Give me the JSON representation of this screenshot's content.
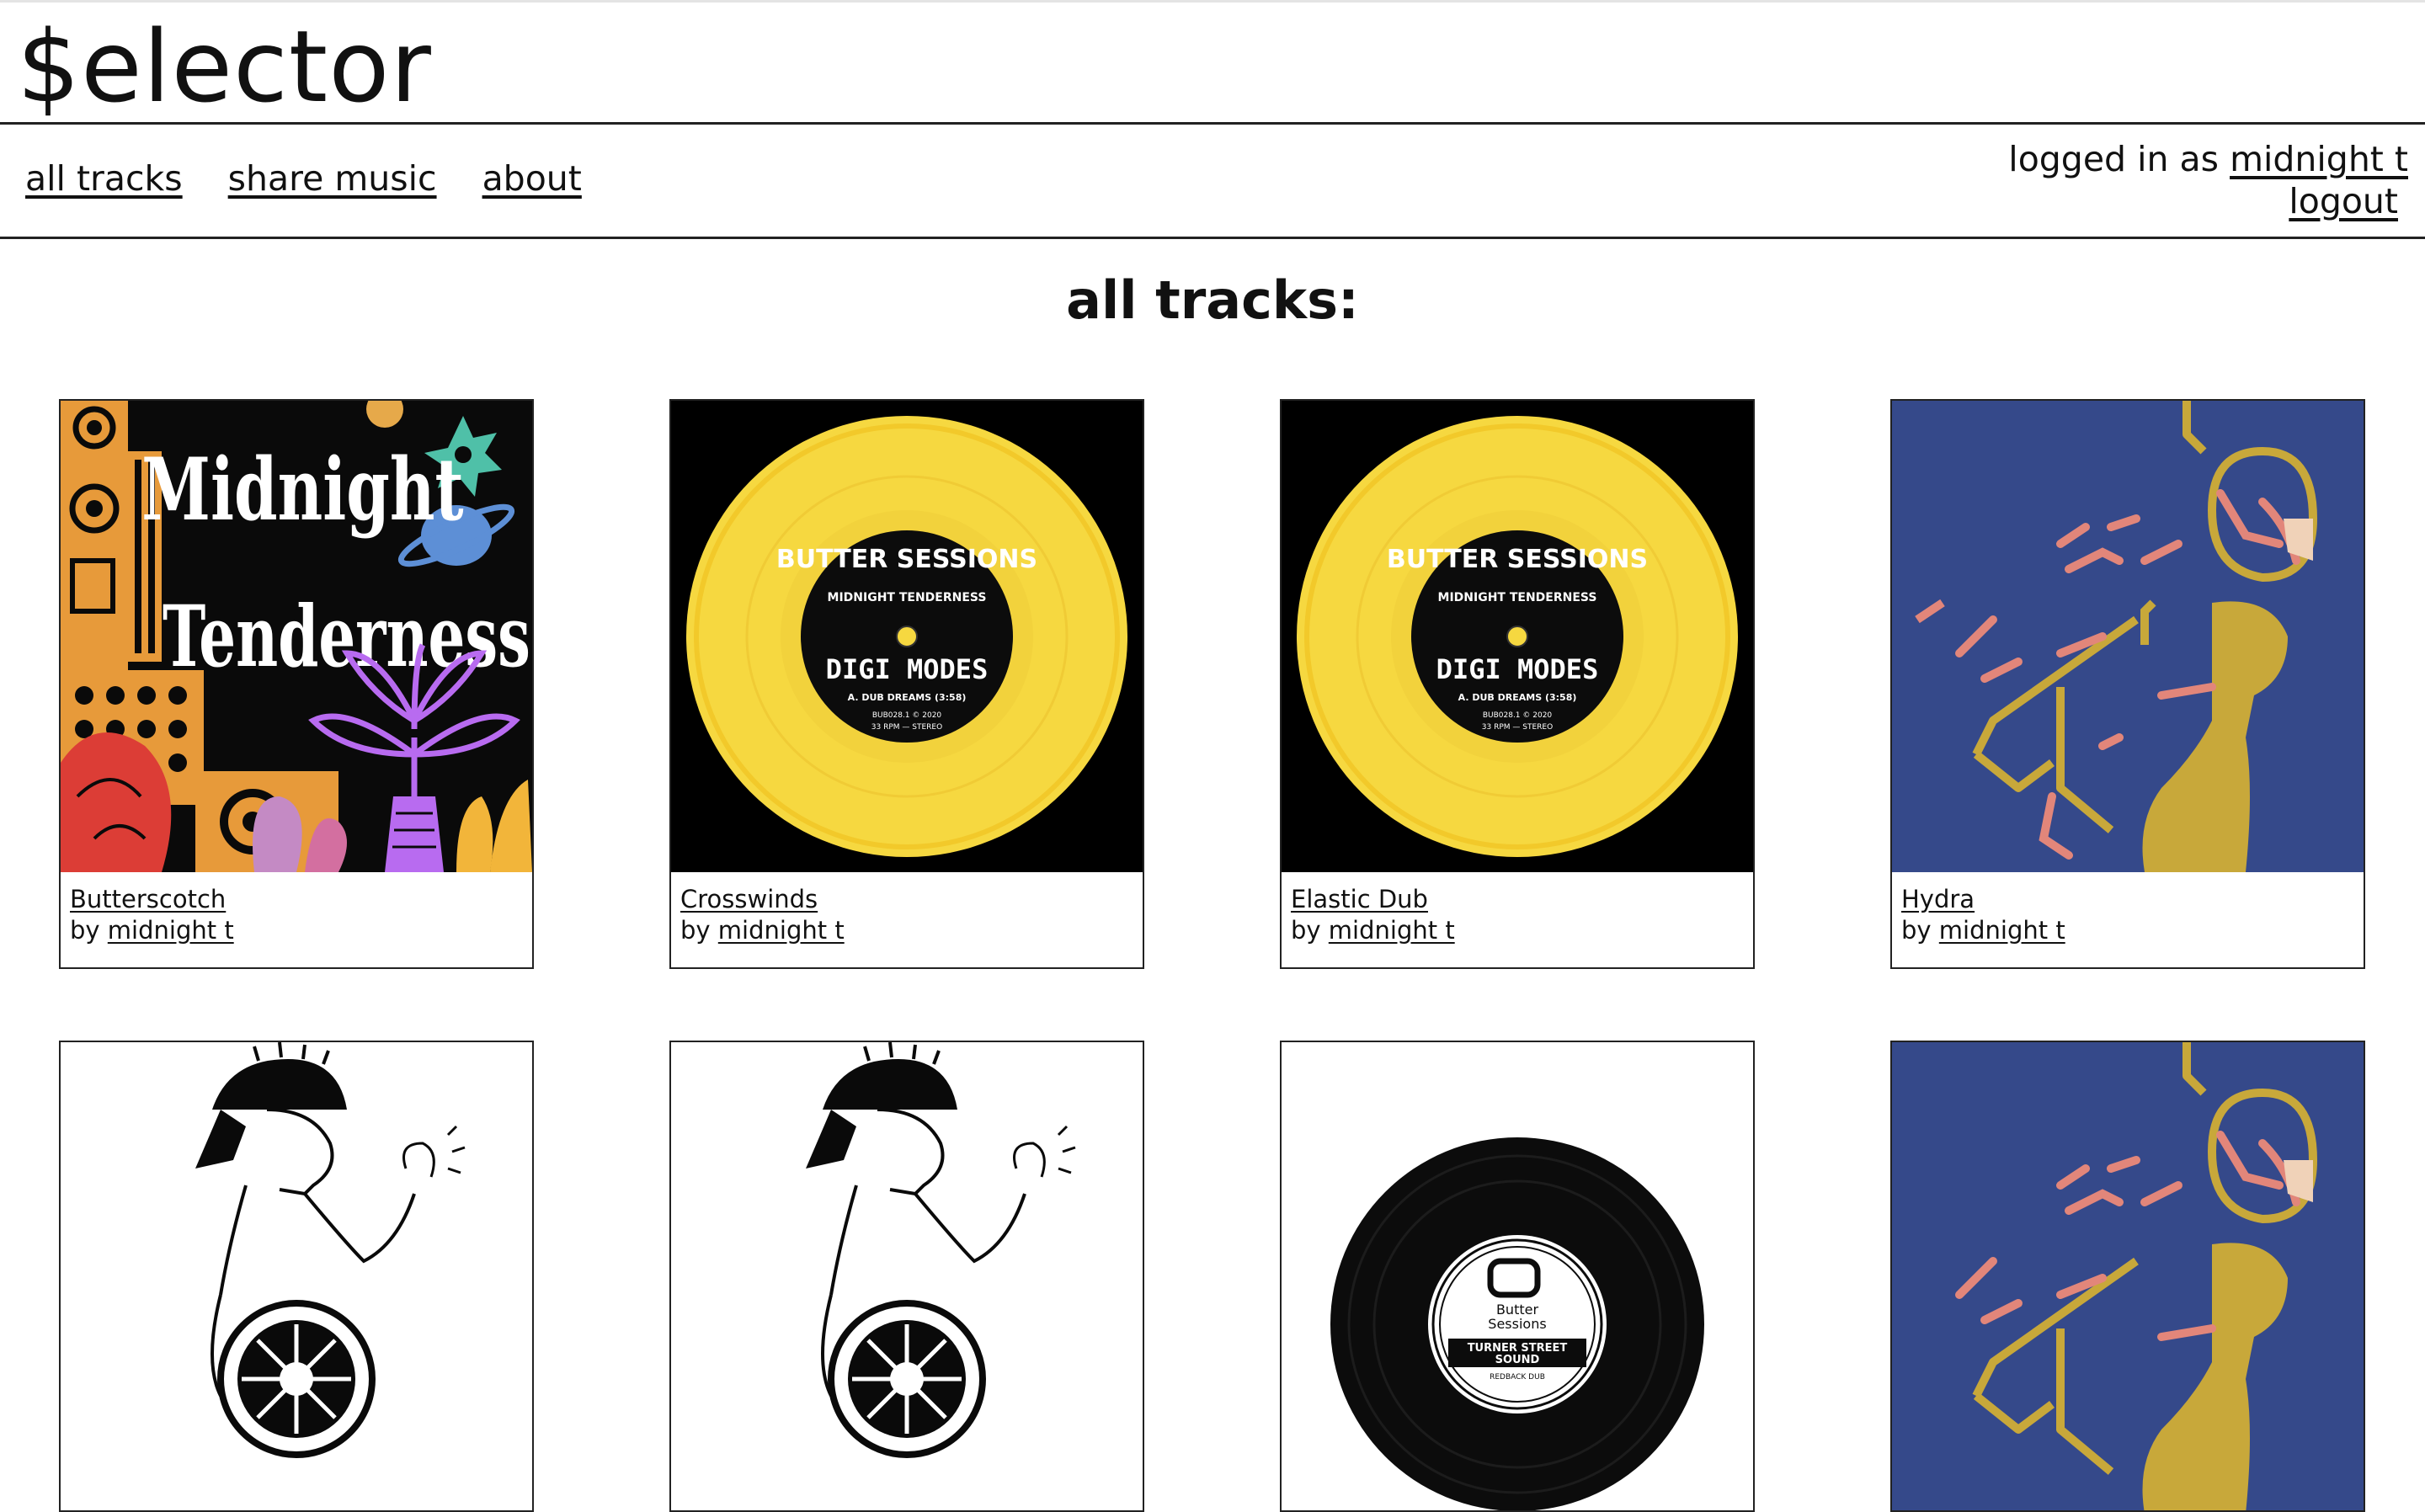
{
  "site": {
    "brand": "$elector"
  },
  "nav": {
    "items": [
      {
        "label": "all tracks"
      },
      {
        "label": "share music"
      },
      {
        "label": "about"
      }
    ]
  },
  "auth": {
    "prefix": "logged in as",
    "username": "midnight t",
    "logout_label": "logout"
  },
  "main": {
    "heading": "all tracks:"
  },
  "tracks": [
    {
      "title": "Butterscotch",
      "by": "by",
      "artist": "midnight t",
      "cover": {
        "line1": "Midnight",
        "line2": "Tenderness"
      }
    },
    {
      "title": "Crosswinds",
      "by": "by",
      "artist": "midnight t",
      "cover": {
        "ring": "BUTTER SESSIONS",
        "artist": "MIDNIGHT TENDERNESS",
        "release": "DIGI MODES",
        "track": "A. DUB DREAMS (3:58)",
        "cat": "BUB028.1 © 2020",
        "speed": "33 RPM — STEREO"
      }
    },
    {
      "title": "Elastic Dub",
      "by": "by",
      "artist": "midnight t",
      "cover": {
        "ring": "BUTTER SESSIONS",
        "artist": "MIDNIGHT TENDERNESS",
        "release": "DIGI MODES",
        "track": "A. DUB DREAMS (3:58)",
        "cat": "BUB028.1 © 2020",
        "speed": "33 RPM — STEREO"
      }
    },
    {
      "title": "Hydra",
      "by": "by",
      "artist": "midnight t"
    },
    {
      "title": "",
      "by": "",
      "artist": ""
    },
    {
      "title": "",
      "by": "",
      "artist": ""
    },
    {
      "title": "",
      "by": "",
      "artist": "",
      "cover": {
        "brand1": "Butter",
        "brand2": "Sessions",
        "title1": "TURNER STREET",
        "title2": "SOUND",
        "subtitle": "REDBACK DUB"
      }
    },
    {
      "title": "",
      "by": "",
      "artist": ""
    }
  ],
  "colors": {
    "vinyl_yellow": "#f6d840",
    "hydra_blue": "#35498a",
    "hydra_pink": "#e2867a",
    "hydra_olive": "#c8a83a",
    "label_black": "#0c0c0c"
  }
}
